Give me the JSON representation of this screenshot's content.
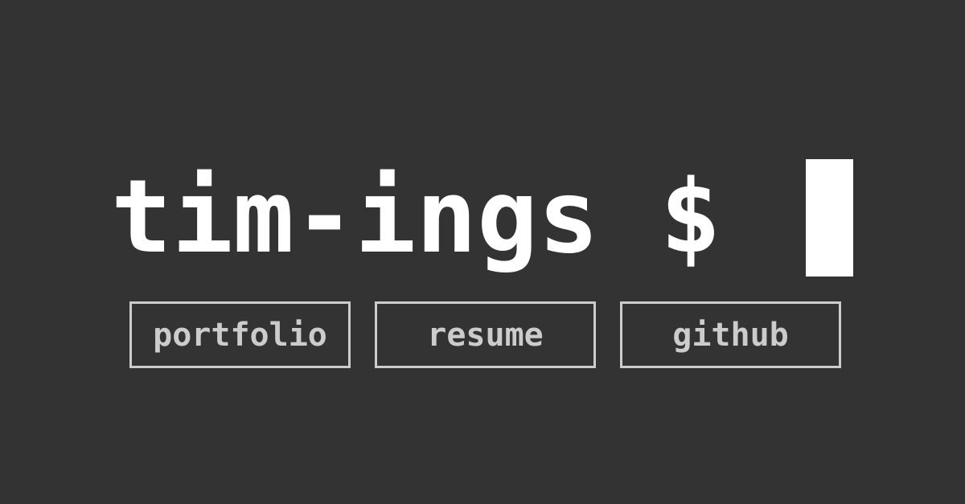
{
  "hero": {
    "title": "tim-ings $",
    "cursor_color": "#ffffff",
    "background_color": "#333333"
  },
  "links": [
    {
      "label": "portfolio"
    },
    {
      "label": "resume"
    },
    {
      "label": "github"
    }
  ],
  "colors": {
    "title": "#ffffff",
    "link_text": "#cccccc",
    "link_border": "#cccccc"
  }
}
